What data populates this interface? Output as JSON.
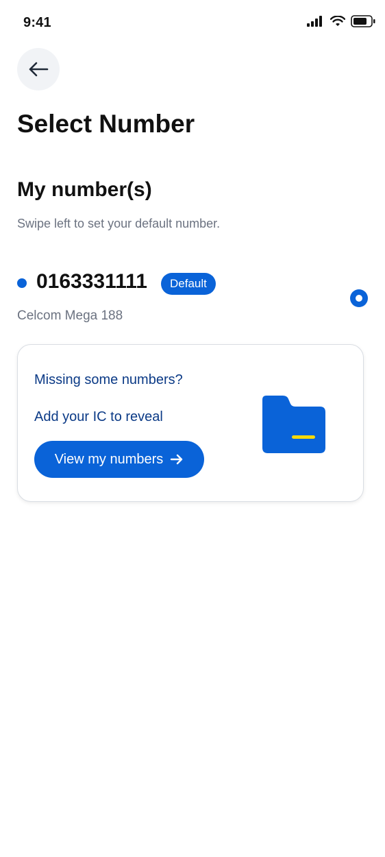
{
  "status_bar": {
    "time": "9:41",
    "icons": [
      "cellular-signal-icon",
      "wifi-icon",
      "battery-icon"
    ]
  },
  "header": {
    "back_icon": "arrow-left-icon",
    "title": "Select Number"
  },
  "my_numbers": {
    "title": "My number(s)",
    "subtitle": "Swipe left to set your default number.",
    "items": [
      {
        "number": "0163331111",
        "badge": "Default",
        "plan": "Celcom Mega 188",
        "selected": true
      }
    ]
  },
  "missing_card": {
    "heading": "Missing some numbers?",
    "subheading": "Add your IC to reveal",
    "button_label": "View my numbers",
    "button_icon": "arrow-right-icon",
    "illustration": "folder-icon"
  },
  "colors": {
    "primary": "#0a63d8",
    "primary_dark": "#0b3a86",
    "accent_yellow": "#f5d90a",
    "muted_text": "#6b7280",
    "back_button_bg": "#f1f3f6"
  }
}
